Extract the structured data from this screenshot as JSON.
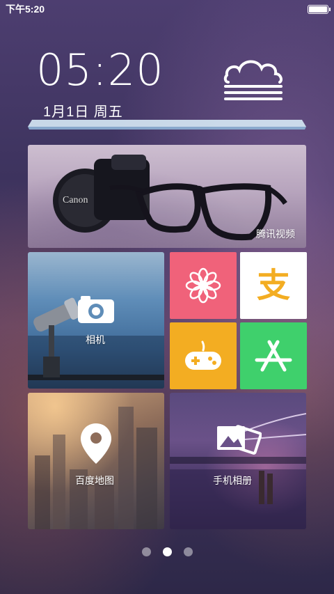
{
  "status_bar": {
    "time": "下午5:20",
    "battery_level": 1.0
  },
  "clock": {
    "time": "05:20",
    "date": "1月1日  周五",
    "weather_icon": "fog-cloud-icon"
  },
  "tiles": {
    "video": {
      "label": "腾讯视频",
      "image_brand": "Canon"
    },
    "camera": {
      "label": "相机",
      "icon": "camera-icon"
    },
    "flower": {
      "icon": "flower-icon",
      "color": "#f0627a"
    },
    "alipay": {
      "icon": "alipay-icon",
      "glyph": "支",
      "color": "#ffffff"
    },
    "game": {
      "icon": "gamepad-icon",
      "color": "#f3ad22"
    },
    "store": {
      "icon": "app-store-icon",
      "color": "#3fd06c"
    },
    "map": {
      "label": "百度地图",
      "icon": "map-pin-icon"
    },
    "album": {
      "label": "手机相册",
      "icon": "photos-icon"
    }
  },
  "page_indicator": {
    "total": 3,
    "active": 2
  }
}
